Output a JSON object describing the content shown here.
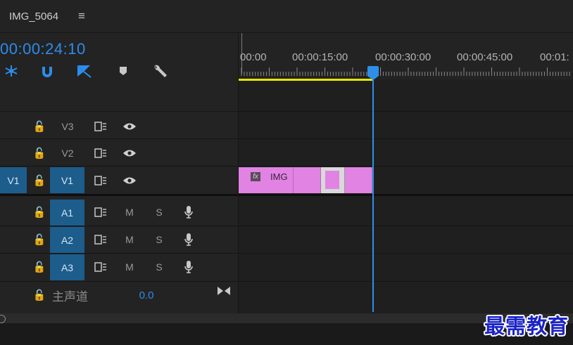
{
  "sequence": {
    "name": "IMG_5064",
    "menu_icon": "hamburger-icon"
  },
  "timecode": "00:00:24:10",
  "tools": [
    "snap-icon",
    "linked-selection-icon",
    "add-marker-icon",
    "marker-icon",
    "wrench-icon"
  ],
  "ruler": {
    "labels": [
      "00:00",
      "00:00:15:00",
      "00:00:30:00",
      "00:00:45:00",
      "00:01:"
    ]
  },
  "playhead_fraction": 0.45,
  "tracks": {
    "video": [
      {
        "name": "V3",
        "source": "",
        "active": false
      },
      {
        "name": "V2",
        "source": "",
        "active": false
      },
      {
        "name": "V1",
        "source": "V1",
        "active": true
      }
    ],
    "audio": [
      {
        "name": "A1",
        "mute": "M",
        "solo": "S"
      },
      {
        "name": "A2",
        "mute": "M",
        "solo": "S"
      },
      {
        "name": "A3",
        "mute": "M",
        "solo": "S"
      }
    ],
    "master": {
      "name": "主声道",
      "value": "0.0"
    }
  },
  "clip": {
    "label": "IMG",
    "fx_label": "fx",
    "color": "#e183e2"
  },
  "colors": {
    "accent": "#2d8ceb",
    "work_area": "#e6e600",
    "clip": "#e183e2"
  },
  "watermark": "最需教育"
}
